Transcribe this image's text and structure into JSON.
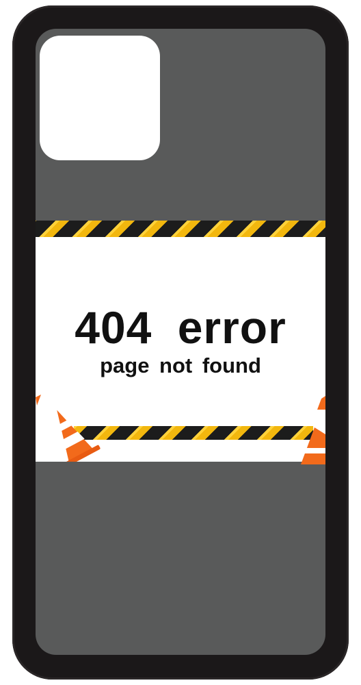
{
  "graphic": {
    "headline": "404  error",
    "subline": "page not found"
  },
  "colors": {
    "case": "#1b1819",
    "back": "#595a5a",
    "tape_yellow": "#f2b70e",
    "tape_black": "#1c1c1c",
    "cone_orange": "#f26a1b",
    "text": "#111111"
  },
  "icons": [
    "camera-cutout",
    "hazard-tape",
    "traffic-cone"
  ]
}
